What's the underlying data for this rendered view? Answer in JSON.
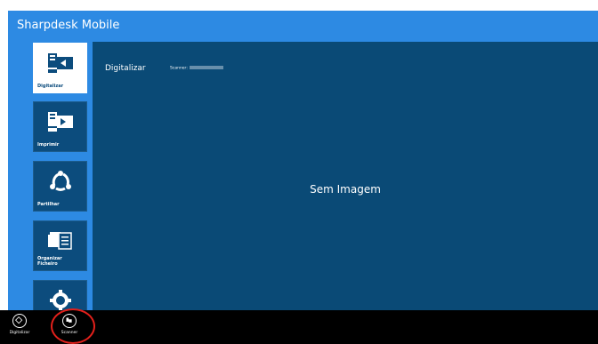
{
  "app": {
    "title": "Sharpdesk Mobile"
  },
  "colors": {
    "accent": "#2d8ae3",
    "tile": "#0c4c7d",
    "content": "#0a4a76",
    "appbar": "#000000",
    "highlight": "#e3201b"
  },
  "nav": {
    "items": [
      {
        "label": "Digitalizar",
        "icon": "scan-icon",
        "selected": true
      },
      {
        "label": "Imprimir",
        "icon": "print-icon",
        "selected": false
      },
      {
        "label": "Partilhar",
        "icon": "share-icon",
        "selected": false
      },
      {
        "label": "Organizar\nFicheiro",
        "icon": "organize-file-icon",
        "selected": false
      },
      {
        "label": "",
        "icon": "settings-icon",
        "selected": false
      }
    ]
  },
  "main": {
    "title": "Digitalizar",
    "scanner_label": "Scanner:",
    "empty_text": "Sem Imagem"
  },
  "appbar": {
    "buttons": [
      {
        "label": "Digitalizar",
        "icon": "scan-start-icon"
      },
      {
        "label": "Scanner",
        "icon": "scanner-icon"
      }
    ]
  }
}
